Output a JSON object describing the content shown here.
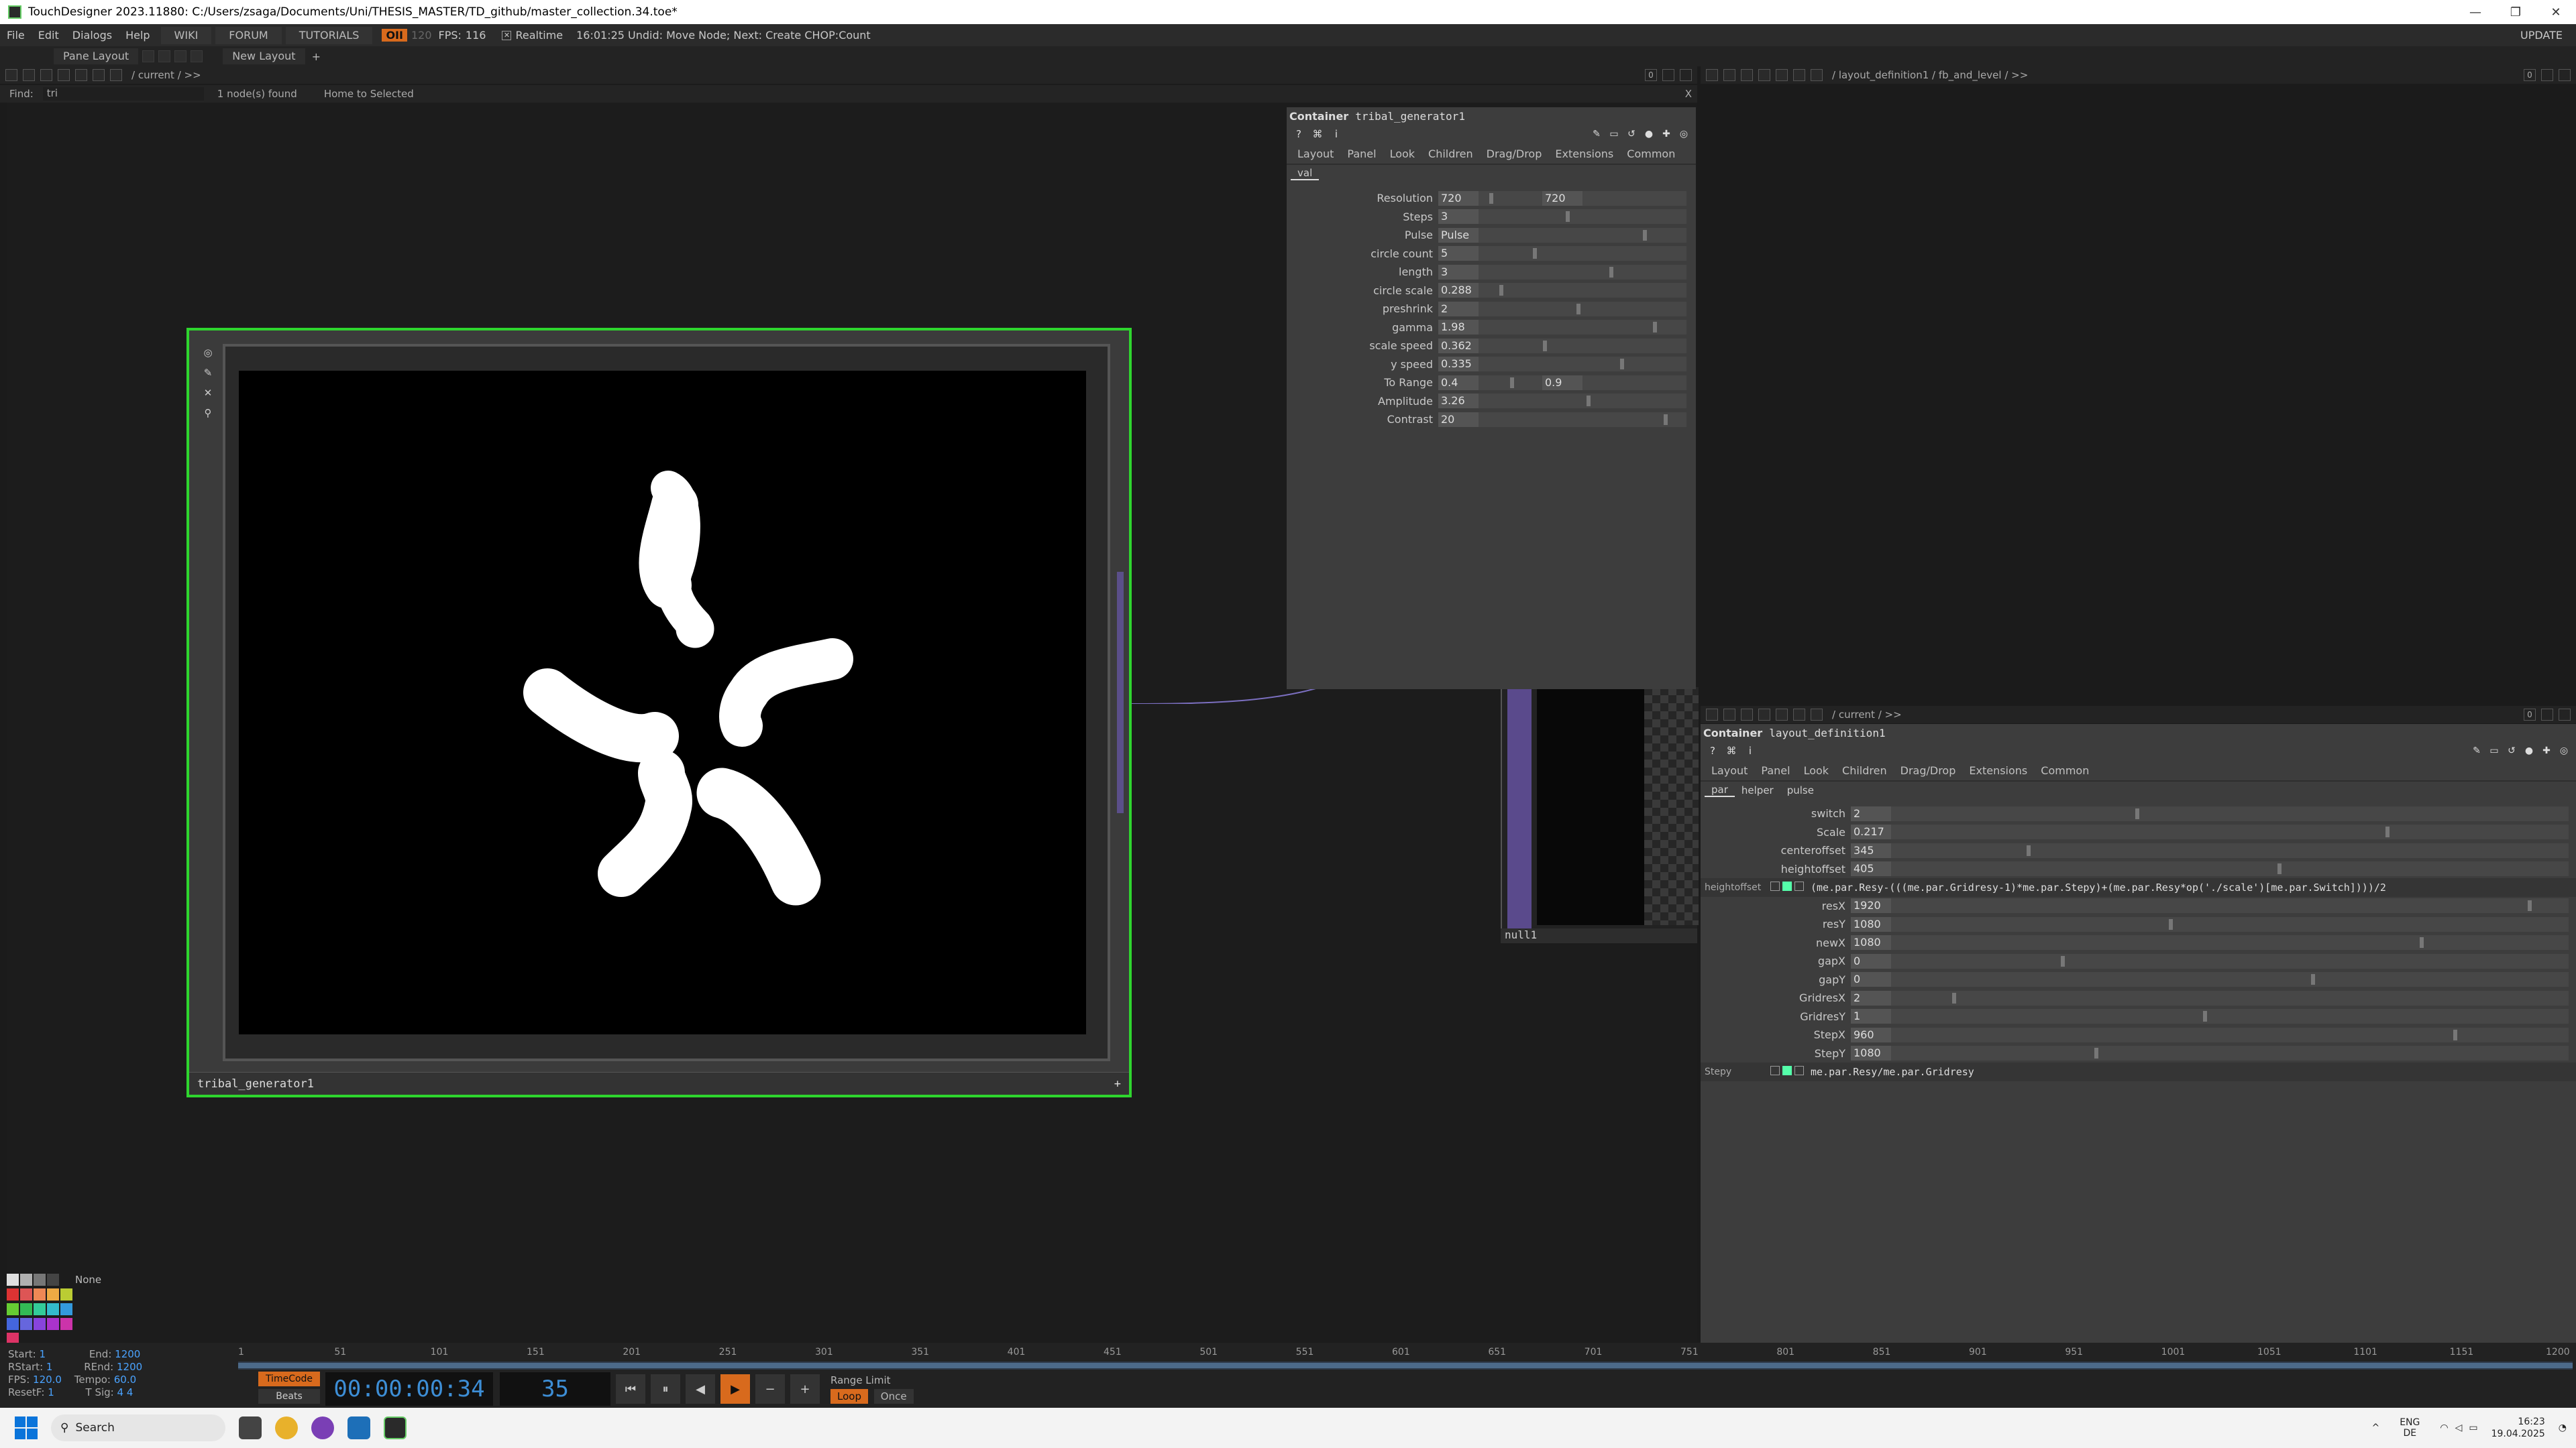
{
  "window": {
    "title": "TouchDesigner 2023.11880: C:/Users/zsaga/Documents/Uni/THESIS_MASTER/TD_github/master_collection.34.toe*",
    "buttons": [
      "—",
      "❐",
      "✕"
    ]
  },
  "menubar": {
    "items": [
      "File",
      "Edit",
      "Dialogs",
      "Help"
    ],
    "tabs": [
      "WIKI",
      "FORUM",
      "TUTORIALS"
    ],
    "tag": "OII",
    "tag2": "120",
    "fps_label": "FPS:",
    "fps_value": "116",
    "realtime_label": "Realtime",
    "status": "16:01:25 Undid: Move Node; Next: Create CHOP:Count",
    "update": "UPDATE"
  },
  "panebar": {
    "pane_layout": "Pane Layout",
    "new_layout": "New Layout",
    "add": "+"
  },
  "left_path": {
    "path": "/ current / >>",
    "zero": "0"
  },
  "right_path": {
    "path": "/ layout_definition1 / fb_and_level / >>",
    "zero": "0"
  },
  "findbar": {
    "label": "Find:",
    "value": "tri",
    "result": "1 node(s) found",
    "home": "Home to Selected",
    "close": "X"
  },
  "node": {
    "label": "tribal_generator1",
    "plus": "+"
  },
  "nullnode": {
    "label": "null1"
  },
  "panel1": {
    "type": "Container",
    "name": "tribal_generator1",
    "tabs": [
      "Layout",
      "Panel",
      "Look",
      "Children",
      "Drag/Drop",
      "Extensions",
      "Common"
    ],
    "subtabs": [
      "val"
    ],
    "params": [
      {
        "label": "Resolution",
        "value": "720",
        "value2": "720"
      },
      {
        "label": "Steps",
        "value": "3"
      },
      {
        "label": "Pulse",
        "value": "Pulse"
      },
      {
        "label": "circle count",
        "value": "5"
      },
      {
        "label": "length",
        "value": "3"
      },
      {
        "label": "circle scale",
        "value": "0.288"
      },
      {
        "label": "preshrink",
        "value": "2"
      },
      {
        "label": "gamma",
        "value": "1.98"
      },
      {
        "label": "scale speed",
        "value": "0.362"
      },
      {
        "label": "y speed",
        "value": "0.335"
      },
      {
        "label": "To Range",
        "value": "0.4",
        "value2": "0.9"
      },
      {
        "label": "Amplitude",
        "value": "3.26"
      },
      {
        "label": "Contrast",
        "value": "20"
      }
    ]
  },
  "panel2": {
    "path": "/ current / >>",
    "zero": "0",
    "type": "Container",
    "name": "layout_definition1",
    "tabs": [
      "Layout",
      "Panel",
      "Look",
      "Children",
      "Drag/Drop",
      "Extensions",
      "Common"
    ],
    "subtabs": [
      "par",
      "helper",
      "pulse"
    ],
    "params": [
      {
        "label": "switch",
        "value": "2"
      },
      {
        "label": "Scale",
        "value": "0.217"
      },
      {
        "label": "centeroffset",
        "value": "345"
      },
      {
        "label": "heightoffset",
        "value": "405"
      }
    ],
    "expr1_label": "heightoffset",
    "expr1": "(me.par.Resy-(((me.par.Gridresy-1)*me.par.Stepy)+(me.par.Resy*op('./scale')[me.par.Switch])))/2",
    "params2": [
      {
        "label": "resX",
        "value": "1920"
      },
      {
        "label": "resY",
        "value": "1080"
      },
      {
        "label": "newX",
        "value": "1080"
      },
      {
        "label": "gapX",
        "value": "0"
      },
      {
        "label": "gapY",
        "value": "0"
      },
      {
        "label": "GridresX",
        "value": "2"
      },
      {
        "label": "GridresY",
        "value": "1"
      },
      {
        "label": "StepX",
        "value": "960"
      },
      {
        "label": "StepY",
        "value": "1080"
      }
    ],
    "expr2_label": "Stepy",
    "expr2": "me.par.Resy/me.par.Gridresy"
  },
  "timeline": {
    "start_label": "Start:",
    "start": "1",
    "rstart_label": "RStart:",
    "rstart": "1",
    "fps_label": "FPS:",
    "fps": "120.0",
    "resetf_label": "ResetF:",
    "resetf": "1",
    "end_label": "End:",
    "end": "1200",
    "rend_label": "REnd:",
    "rend": "1200",
    "tempo_label": "Tempo:",
    "tempo": "60.0",
    "tsig_label": "T Sig:",
    "tsig": "4    4",
    "ruler": [
      "1",
      "51",
      "101",
      "151",
      "201",
      "251",
      "301",
      "351",
      "401",
      "451",
      "501",
      "551",
      "601",
      "651",
      "701",
      "751",
      "801",
      "851",
      "901",
      "951",
      "1001",
      "1051",
      "1101",
      "1151",
      "1200"
    ],
    "timecode": "TimeCode",
    "beats": "Beats",
    "time": "00:00:00:34",
    "frame": "35",
    "range_limit": "Range Limit",
    "loop": "Loop",
    "once": "Once",
    "none": "None"
  },
  "taskbar": {
    "search": "Search",
    "lang1": "ENG",
    "lang2": "DE",
    "time": "16:23",
    "date": "19.04.2025"
  },
  "colors": {
    "selection_green": "#2ed52e",
    "accent_orange": "#d86a1d",
    "timecode_blue": "#3d8ed6"
  }
}
